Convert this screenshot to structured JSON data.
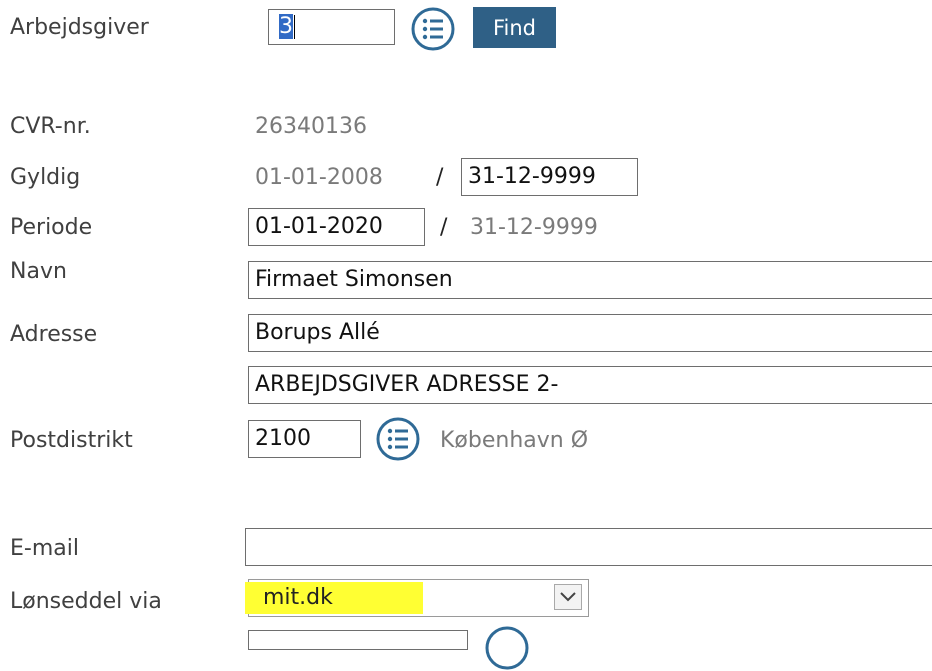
{
  "labels": {
    "arbejdsgiver": "Arbejdsgiver",
    "cvr": "CVR-nr.",
    "gyldig": "Gyldig",
    "periode": "Periode",
    "navn": "Navn",
    "adresse": "Adresse",
    "postdistrikt": "Postdistrikt",
    "email": "E-mail",
    "lonseddel": "Lønseddel via"
  },
  "arbejdsgiver": {
    "value": "3",
    "find_label": "Find"
  },
  "cvr": {
    "value": "26340136"
  },
  "gyldig": {
    "from": "01-01-2008",
    "separator": "/",
    "to": "31-12-9999"
  },
  "periode": {
    "from": "01-01-2020",
    "separator": "/",
    "to": "31-12-9999"
  },
  "navn": {
    "value": "Firmaet Simonsen"
  },
  "adresse": {
    "line1": "Borups Allé",
    "line2": "ARBEJDSGIVER ADRESSE 2-"
  },
  "postdistrikt": {
    "code": "2100",
    "city": "København Ø"
  },
  "email": {
    "value": ""
  },
  "lonseddel": {
    "selected": "mit.dk"
  },
  "colors": {
    "accent": "#2f6086",
    "highlight": "#ffff33",
    "selection": "#316ac5",
    "icon": "#2f6a96"
  },
  "icons": {
    "lookup": "list-icon",
    "dropdown": "chevron-down-icon"
  }
}
